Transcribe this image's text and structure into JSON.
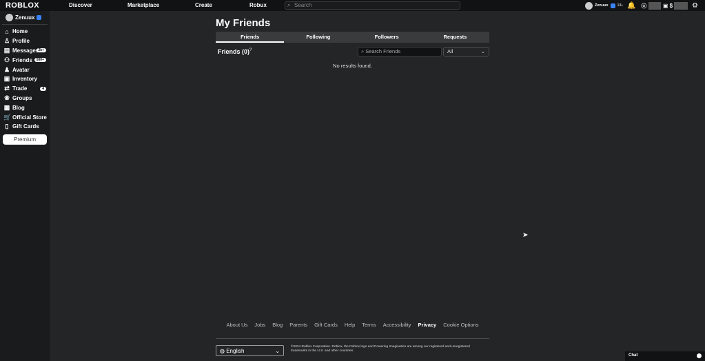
{
  "header": {
    "logo": "ROBLOX",
    "nav": [
      "Discover",
      "Marketplace",
      "Create",
      "Robux"
    ],
    "search_placeholder": "Search",
    "username": "Zenuux",
    "age": "13+"
  },
  "sidebar": {
    "username": "Zenuux",
    "items": [
      {
        "label": "Home",
        "icon": "⌂"
      },
      {
        "label": "Profile",
        "icon": "♙"
      },
      {
        "label": "Messages",
        "icon": "▤",
        "badge": "2k+"
      },
      {
        "label": "Friends",
        "icon": "⚇",
        "badge": "500+"
      },
      {
        "label": "Avatar",
        "icon": "♟"
      },
      {
        "label": "Inventory",
        "icon": "▣"
      },
      {
        "label": "Trade",
        "icon": "⇄",
        "badge": "4"
      },
      {
        "label": "Groups",
        "icon": "❀"
      },
      {
        "label": "Blog",
        "icon": "▦"
      },
      {
        "label": "Official Store",
        "icon": "🛒"
      },
      {
        "label": "Gift Cards",
        "icon": "▯"
      }
    ],
    "premium": "Premium"
  },
  "main": {
    "title": "My Friends",
    "tabs": [
      "Friends",
      "Following",
      "Followers",
      "Requests"
    ],
    "count_label": "Friends (0)",
    "help": "?",
    "search_placeholder": "Search Friends",
    "filter": "All",
    "empty": "No results found."
  },
  "footer": {
    "links": [
      "About Us",
      "Jobs",
      "Blog",
      "Parents",
      "Gift Cards",
      "Help",
      "Terms",
      "Accessibility",
      "Privacy",
      "Cookie Options"
    ],
    "language": "English",
    "copyright": "©2024 Roblox Corporation. Roblox, the Roblox logo and Powering Imagination are among our registered and unregistered trademarks in the U.S. and other countries."
  },
  "chat": {
    "label": "Chat"
  }
}
